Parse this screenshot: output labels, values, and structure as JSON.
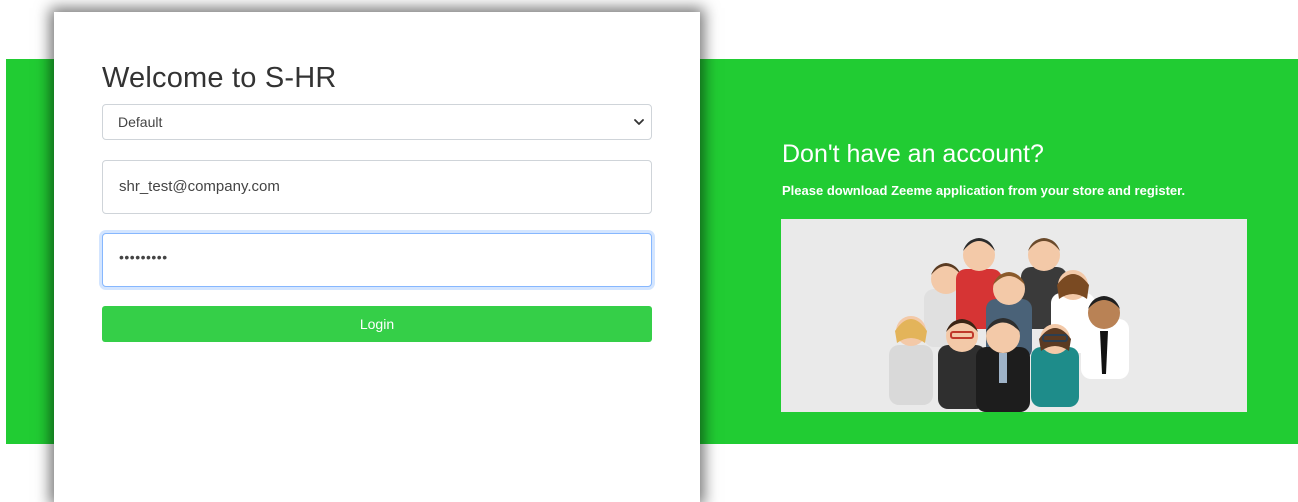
{
  "login": {
    "title": "Welcome to S-HR",
    "company_select": {
      "selected": "Default"
    },
    "email_field": {
      "value": "shr_test@company.com"
    },
    "password_field": {
      "value": "•••••••••"
    },
    "login_button_label": "Login"
  },
  "signup_panel": {
    "heading": "Don't have an account?",
    "text": "Please download Zeeme application from your store and register.",
    "illustration": "team-people-illustration"
  },
  "colors": {
    "brand_green": "#21cc33",
    "button_green": "#35cf48",
    "focus_border": "#86b7fe"
  },
  "icons": {
    "select_chevron": "chevron-down-icon"
  }
}
